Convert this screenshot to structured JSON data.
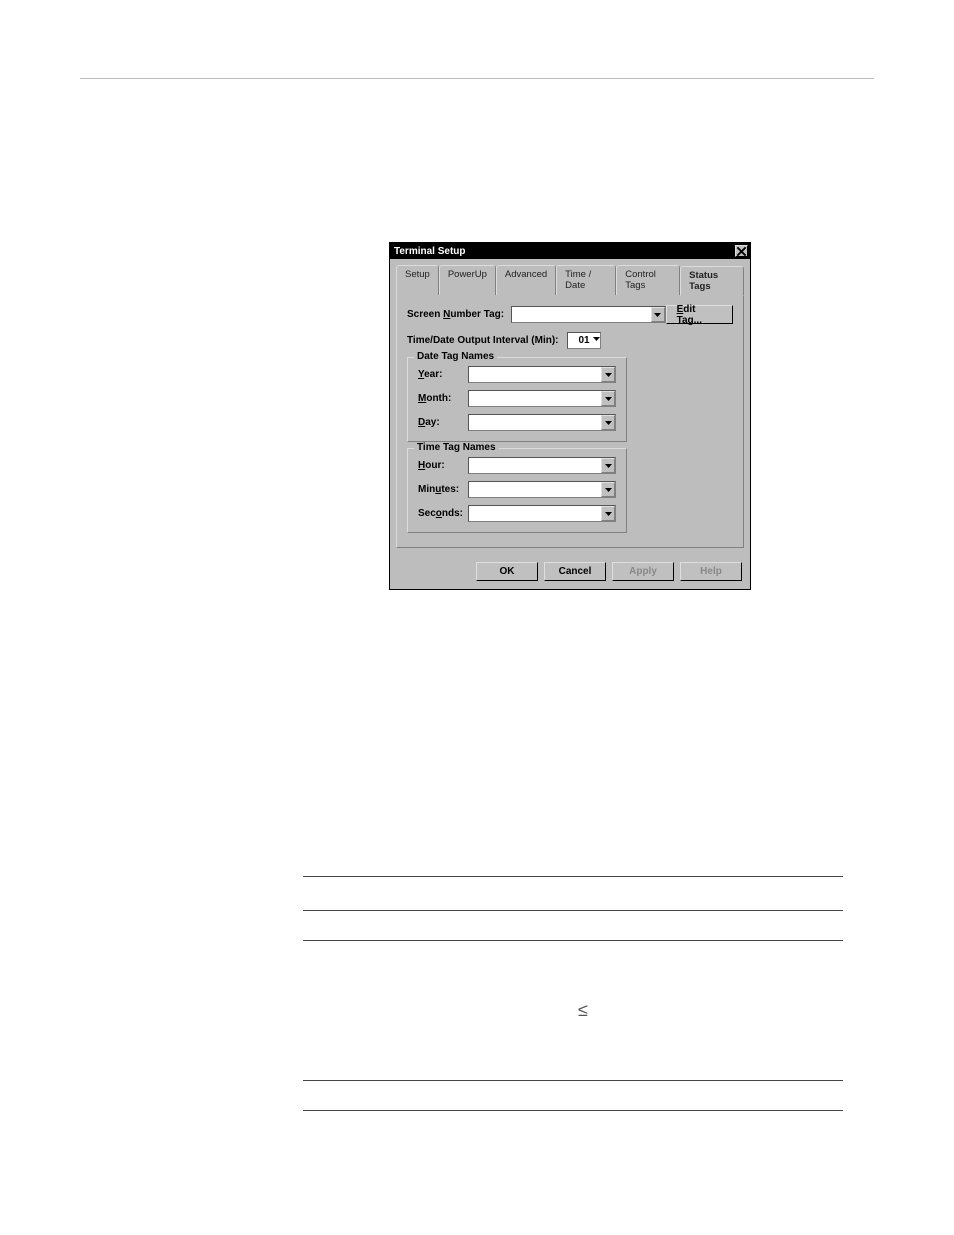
{
  "dialog": {
    "title": "Terminal Setup",
    "tabs": [
      "Setup",
      "PowerUp",
      "Advanced",
      "Time / Date",
      "Control Tags",
      "Status Tags"
    ],
    "activeTab": "Status Tags",
    "screenNumberLabel": "Screen Number Tag:",
    "editTagBtn": "Edit Tag...",
    "intervalLabel": "Time/Date Output Interval (Min):",
    "intervalValue": "01",
    "dateGroup": {
      "legend": "Date Tag Names",
      "year": "Year:",
      "month": "Month:",
      "day": "Day:"
    },
    "timeGroup": {
      "legend": "Time Tag Names",
      "hour": "Hour:",
      "minutes": "Minutes:",
      "seconds": "Seconds:"
    },
    "buttons": {
      "ok": "OK",
      "cancel": "Cancel",
      "apply": "Apply",
      "help": "Help"
    }
  }
}
